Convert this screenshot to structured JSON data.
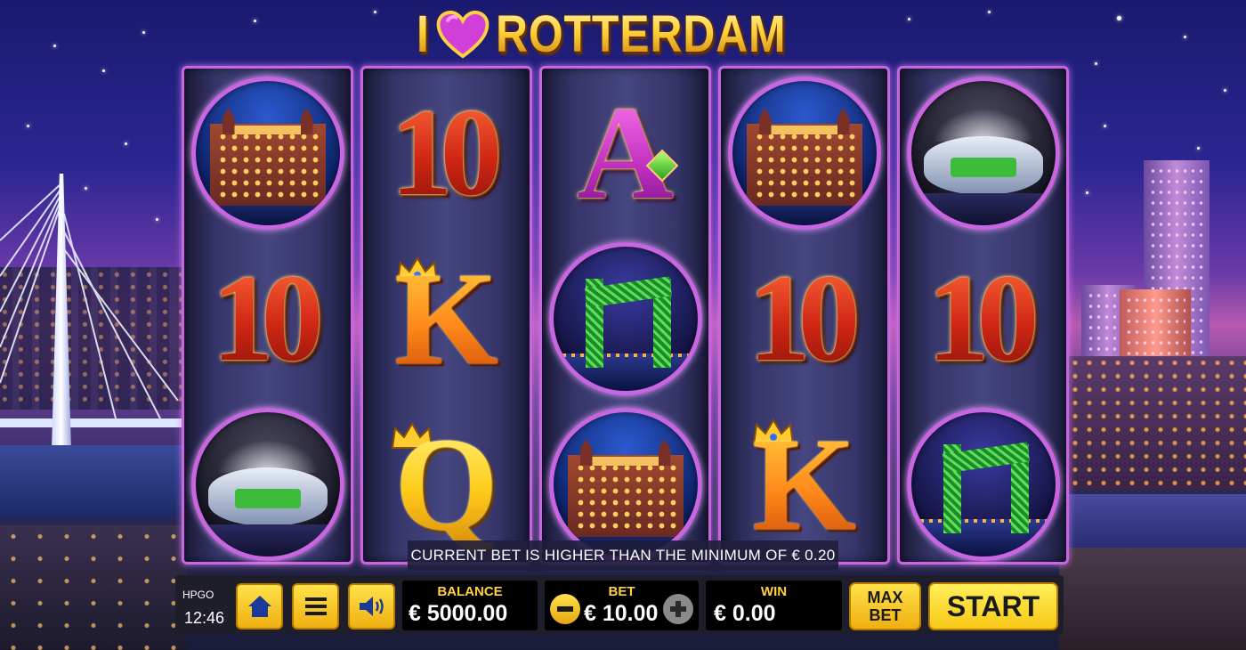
{
  "game": {
    "title_prefix": "I",
    "title_main": "ROTTERDAM",
    "title_icon": "heart-icon"
  },
  "reels": [
    [
      "hotel-new-york",
      "10",
      "stadium"
    ],
    [
      "10",
      "K",
      "Q"
    ],
    [
      "A",
      "bridge-de-hef",
      "hotel-new-york"
    ],
    [
      "hotel-new-york",
      "10",
      "K"
    ],
    [
      "stadium",
      "10",
      "bridge-de-hef"
    ]
  ],
  "symbols": {
    "ten": "10",
    "ace": "A",
    "king": "K",
    "queen": "Q"
  },
  "message": "CURRENT BET IS HIGHER THAN THE MINIMUM OF € 0.20",
  "controls": {
    "brand": "HPGO",
    "clock": "12:46",
    "home_icon": "home-icon",
    "menu_icon": "menu-icon",
    "sound_icon": "speaker-icon",
    "balance_label": "BALANCE",
    "balance_value": "€ 5000.00",
    "bet_label": "BET",
    "bet_value": "€ 10.00",
    "win_label": "WIN",
    "win_value": "€ 0.00",
    "max_bet_line1": "MAX",
    "max_bet_line2": "BET",
    "start_label": "START"
  },
  "colors": {
    "accent_purple": "#c865e0",
    "button_yellow": "#f7c816",
    "label_gold": "#ffd23a"
  }
}
